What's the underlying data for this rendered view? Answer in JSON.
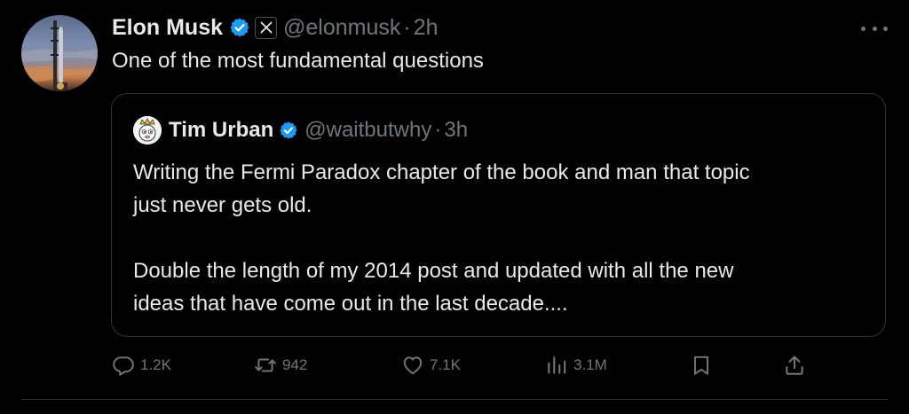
{
  "author": {
    "name": "Elon Musk",
    "handle": "@elonmusk",
    "time": "2h",
    "separator": "·"
  },
  "tweet_text": "One of the most fundamental questions",
  "quoted": {
    "name": "Tim Urban",
    "handle": "@waitbutwhy",
    "time": "3h",
    "separator": "·",
    "paragraphs": [
      "Writing the Fermi Paradox chapter of the book and man that topic\njust never gets old.",
      "Double the length of my 2014 post and updated with all the new\nideas that have come out in the last decade...."
    ]
  },
  "actions": {
    "replies": "1.2K",
    "reposts": "942",
    "likes": "7.1K",
    "views": "3.1M"
  },
  "icons": {
    "verified": "verified-badge-icon",
    "affiliation": "x-logo-icon",
    "more": "more-icon",
    "reply": "reply-icon",
    "repost": "repost-icon",
    "like": "heart-icon",
    "views": "views-icon",
    "bookmark": "bookmark-icon",
    "share": "share-icon"
  },
  "colors": {
    "background": "#000000",
    "text": "#e7e9ea",
    "muted": "#71767b",
    "border": "#2f3336",
    "verified": "#1d9bf0"
  }
}
